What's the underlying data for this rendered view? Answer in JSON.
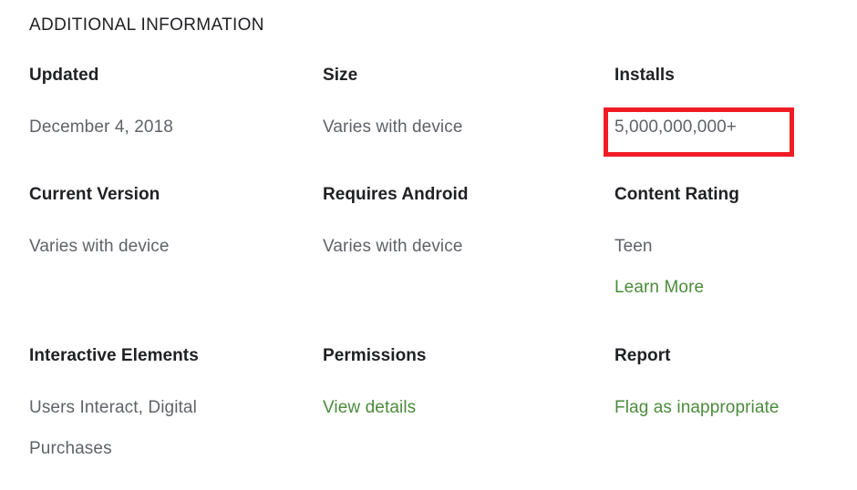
{
  "section": {
    "title": "ADDITIONAL INFORMATION"
  },
  "colors": {
    "label": "#202124",
    "value": "#5f6368",
    "link": "#4b8b3b",
    "highlight": "#ef1c25",
    "background": "#ffffff"
  },
  "rows": [
    {
      "cells": [
        {
          "label": "Updated",
          "values": [
            {
              "text": "December 4, 2018",
              "link": false
            }
          ]
        },
        {
          "label": "Size",
          "values": [
            {
              "text": "Varies with device",
              "link": false
            }
          ]
        },
        {
          "label": "Installs",
          "values": [
            {
              "text": "5,000,000,000+",
              "link": false
            }
          ]
        }
      ]
    },
    {
      "cells": [
        {
          "label": "Current Version",
          "values": [
            {
              "text": "Varies with device",
              "link": false
            }
          ]
        },
        {
          "label": "Requires Android",
          "values": [
            {
              "text": "Varies with device",
              "link": false
            }
          ]
        },
        {
          "label": "Content Rating",
          "values": [
            {
              "text": "Teen",
              "link": false
            },
            {
              "text": "Learn More",
              "link": true
            }
          ]
        }
      ]
    },
    {
      "cells": [
        {
          "label": "Interactive Elements",
          "values": [
            {
              "text": "Users Interact, Digital Purchases",
              "link": false
            }
          ]
        },
        {
          "label": "Permissions",
          "values": [
            {
              "text": "View details",
              "link": true
            }
          ]
        },
        {
          "label": "Report",
          "values": [
            {
              "text": "Flag as inappropriate",
              "link": true
            }
          ]
        }
      ]
    }
  ],
  "annotation": {
    "target": "installs-value",
    "label": "5,000,000,000+"
  }
}
